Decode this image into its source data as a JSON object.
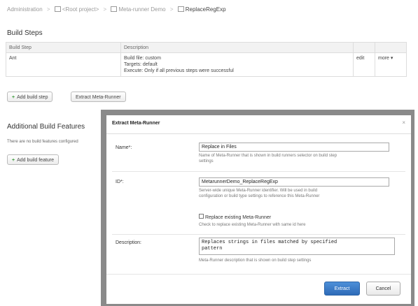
{
  "breadcrumb": {
    "items": [
      "Administration",
      "<Root project>",
      "Meta-runner Demo",
      "ReplaceRegExp"
    ]
  },
  "build_steps": {
    "title": "Build Steps",
    "columns": [
      "Build Step",
      "Description"
    ],
    "rows": [
      {
        "step": "Ant",
        "desc_lines": [
          "Build file: custom",
          "Targets: default",
          "Execute: Only if all previous steps were successful"
        ],
        "edit": "edit",
        "more": "more ▾"
      }
    ],
    "add_step_label": "Add build step",
    "extract_label": "Extract Meta-Runner"
  },
  "features": {
    "title": "Additional Build Features",
    "empty_text": "There are no build features configured",
    "add_label": "Add build feature"
  },
  "dialog": {
    "title": "Extract Meta-Runner",
    "close": "×",
    "name": {
      "label": "Name*:",
      "value": "Replace in Files",
      "hint_lines": [
        "Name of Meta-Runner that is shown in build runners selector on build step",
        "settings"
      ]
    },
    "id": {
      "label": "ID*:",
      "value": "MetarunnerDemo_ReplaceRegExp",
      "hint_lines": [
        "Server-wide unique Meta-Runner identifier. Will be used in build",
        "configuration or build type settings to reference this Meta-Runner"
      ],
      "replace_label": "Replace existing Meta-Runner",
      "replace_hint": "Check to replace existing Meta-Runner with same id here"
    },
    "description": {
      "label": "Description:",
      "value": "Replaces strings in files matched by specified\npattern",
      "hint": "Meta-Runner description that is shown on build step settings"
    },
    "extract_button": "Extract",
    "cancel_button": "Cancel"
  },
  "colors": {
    "primary": "#2e6bb8",
    "dialog_border": "#8a8a8a",
    "link": "#2d6fb5"
  }
}
